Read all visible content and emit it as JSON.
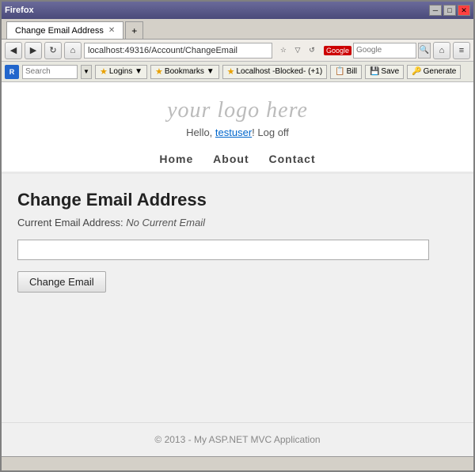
{
  "window": {
    "title": "Firefox",
    "controls": [
      "minimize",
      "maximize",
      "close"
    ]
  },
  "tab": {
    "label": "Change Email Address",
    "new_tab_label": "+"
  },
  "address_bar": {
    "url": "localhost:49316/Account/ChangeEmail"
  },
  "search": {
    "engine": "Google",
    "placeholder": "Google"
  },
  "roboform": {
    "label": "RoboForm",
    "search_placeholder": "Search",
    "logins": "Logins ▼",
    "bookmarks": "Bookmarks ▼",
    "localhost": "Localhost -Blocked- (+1)",
    "bill": "Bill",
    "save": "Save",
    "generate": "Generate"
  },
  "site": {
    "logo": "your logo here",
    "hello_prefix": "Hello, ",
    "username": "testuser",
    "hello_suffix": "! Log off",
    "nav": {
      "home": "Home",
      "about": "About",
      "contact": "Contact"
    }
  },
  "page": {
    "title": "Change Email Address",
    "current_email_label": "Current Email Address:",
    "current_email_value": "No Current Email",
    "email_input_value": "",
    "submit_button": "Change Email"
  },
  "footer": {
    "copyright": "© 2013 - My ASP.NET MVC Application"
  }
}
